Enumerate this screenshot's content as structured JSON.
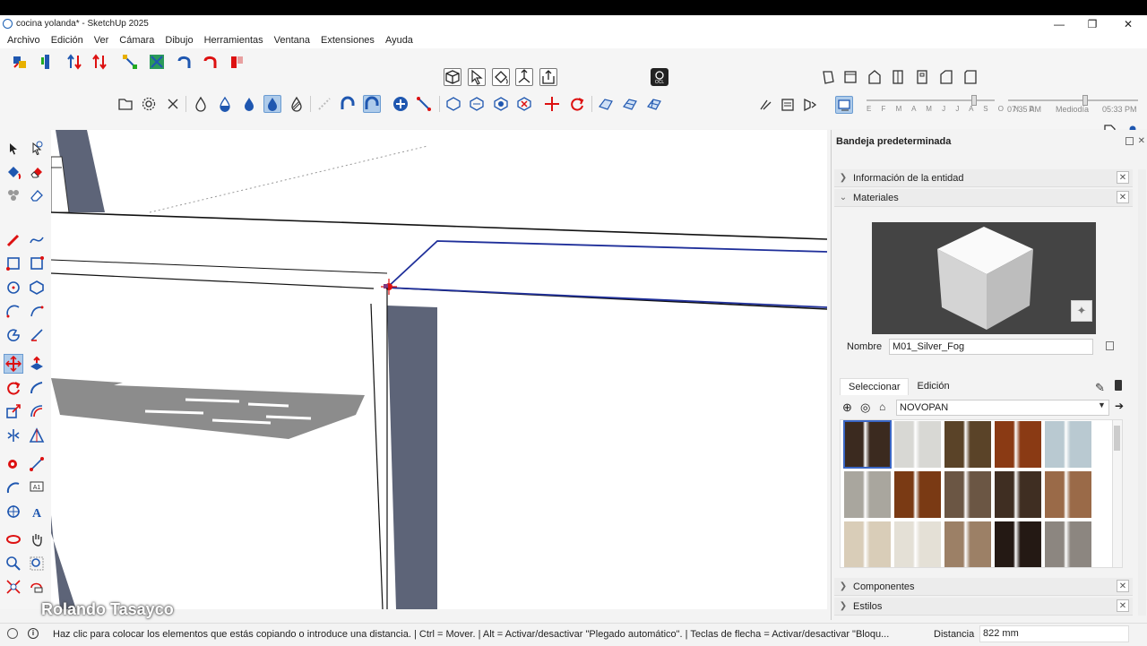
{
  "window": {
    "title": "cocina yolanda* - SketchUp 2025",
    "minimize": "—",
    "restore": "❐",
    "close": "✕"
  },
  "menu": [
    "Archivo",
    "Edición",
    "Ver",
    "Cámara",
    "Dibujo",
    "Herramientas",
    "Ventana",
    "Extensiones",
    "Ayuda"
  ],
  "shadow_settings": {
    "months": "E F M A M J J A S O N D",
    "time_start": "07:35 AM",
    "time_mid": "Mediodía",
    "time_end": "05:33 PM"
  },
  "tray": {
    "title": "Bandeja predeterminada",
    "sections": {
      "entity_info": "Información de la entidad",
      "materials": "Materiales",
      "components": "Componentes",
      "styles": "Estilos"
    },
    "materials": {
      "name_label": "Nombre",
      "name_value": "M01_Silver_Fog",
      "tab_select": "Seleccionar",
      "tab_edit": "Edición",
      "library": "NOVOPAN",
      "swatch_colors": [
        "#3b2a1f",
        "#d8d8d4",
        "#5a4328",
        "#8a3a14",
        "#b9c9d1",
        "#a9a69e",
        "#7a3a14",
        "#6b5644",
        "#3f2e22",
        "#9a6a48",
        "#d9cdb8",
        "#e4e0d6",
        "#9c8066",
        "#241914",
        "#8c8680"
      ]
    }
  },
  "status": {
    "hint": "Haz clic para colocar los elementos que estás copiando o introduce una distancia. | Ctrl = Mover. | Alt = Activar/desactivar \"Plegado automático\". | Teclas de flecha = Activar/desactivar \"Bloqu...",
    "distance_label": "Distancia",
    "distance_value": "822 mm"
  },
  "watermark": "Rolando Tasayco",
  "accent_color": "#1f57b0"
}
